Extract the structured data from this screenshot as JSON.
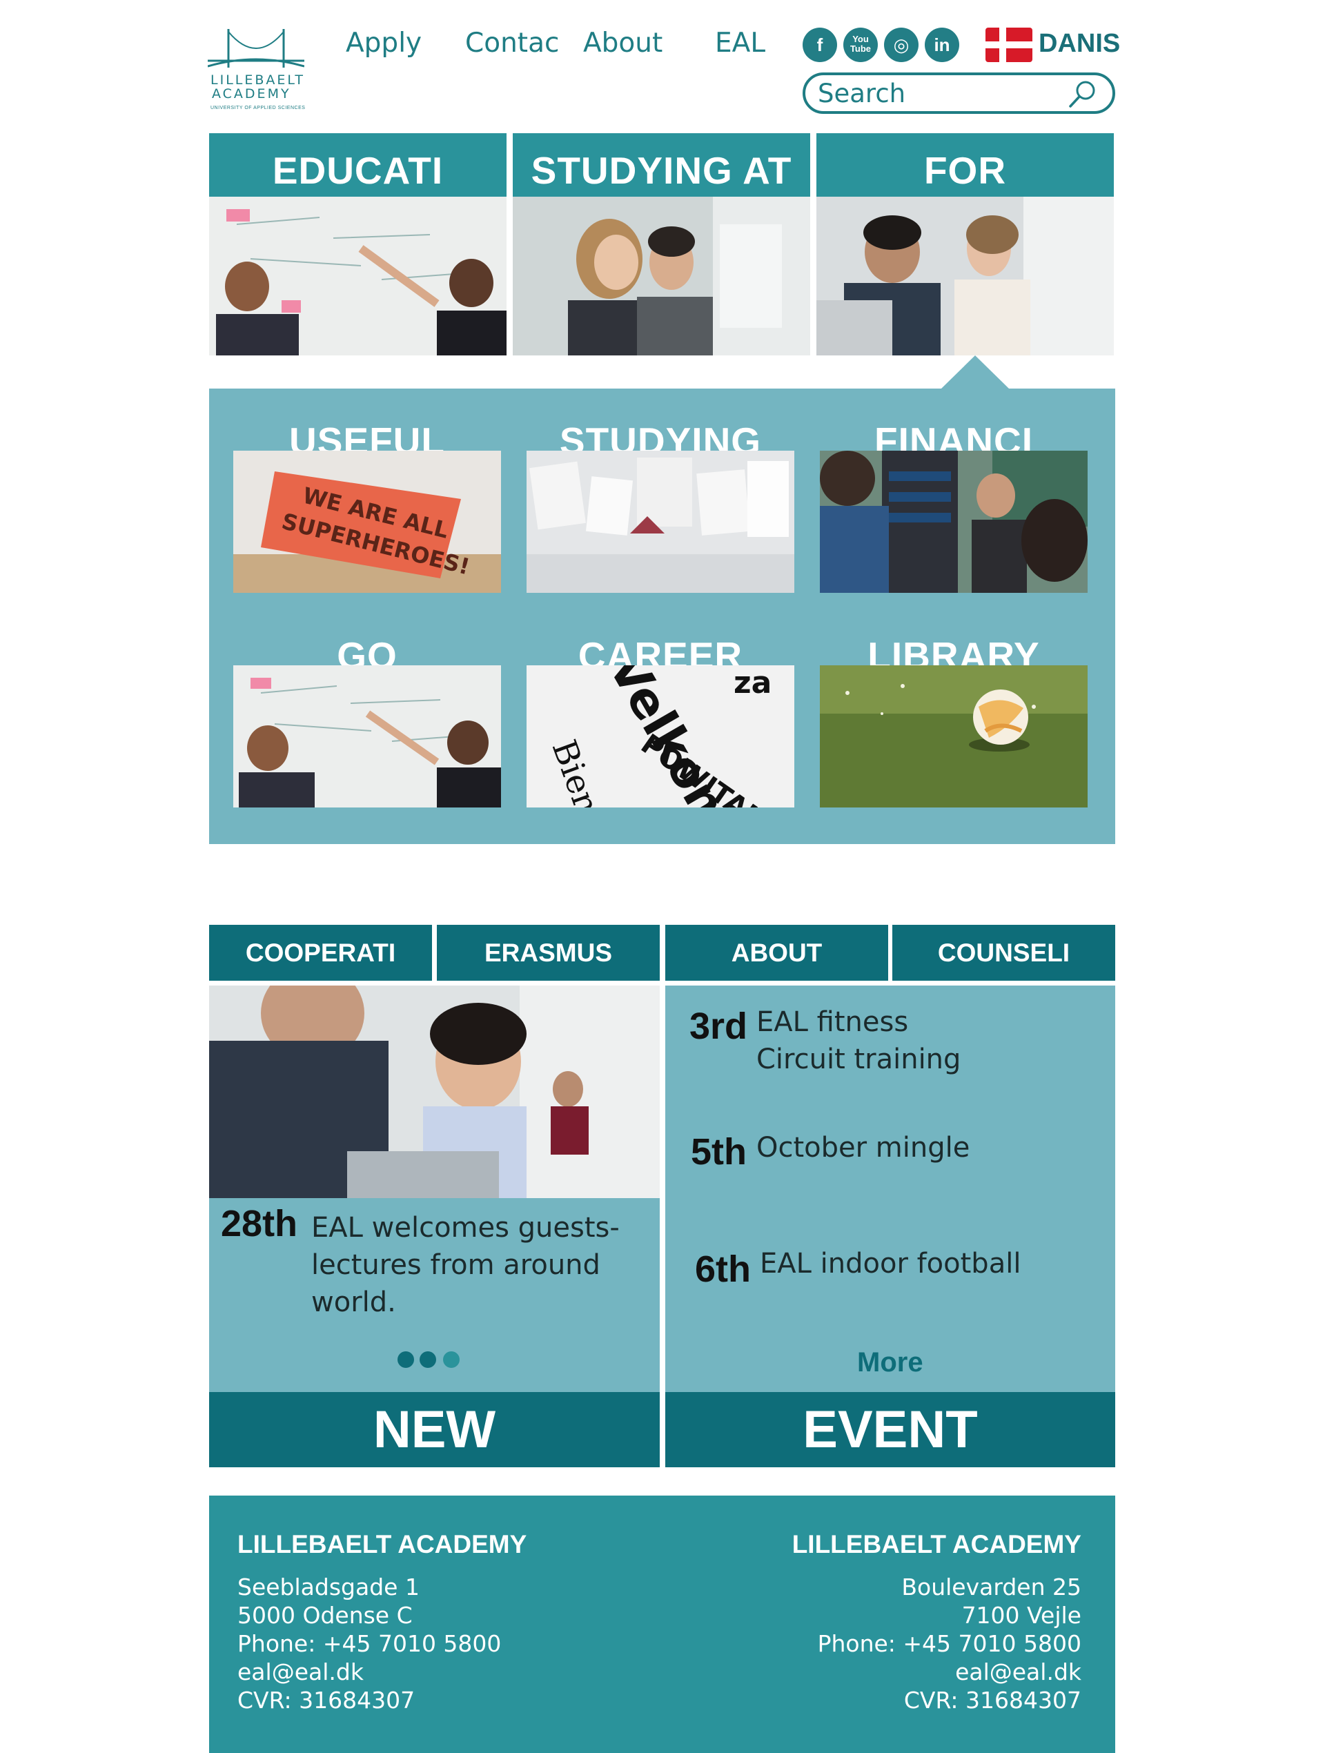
{
  "header": {
    "logo": {
      "line1": "LILLEBAELT",
      "line2": "ACADEMY",
      "tagline": "UNIVERSITY OF APPLIED SCIENCES"
    },
    "nav": [
      {
        "label": "Apply"
      },
      {
        "label": "Contac"
      },
      {
        "label": "About"
      },
      {
        "label": "EAL"
      }
    ],
    "social": [
      {
        "icon": "facebook-icon",
        "glyph": "f"
      },
      {
        "icon": "youtube-icon",
        "glyph": "You Tube"
      },
      {
        "icon": "instagram-icon",
        "glyph": "◎"
      },
      {
        "icon": "linkedin-icon",
        "glyph": "in"
      }
    ],
    "language": "DANIS",
    "search_placeholder": "Search"
  },
  "top_cards": [
    {
      "title": "EDUCATI"
    },
    {
      "title": "STUDYING AT"
    },
    {
      "title": "FOR"
    }
  ],
  "sub_cards": [
    {
      "title": "USEFUL"
    },
    {
      "title": "STUDYING"
    },
    {
      "title": "FINANCI"
    },
    {
      "title": "GO"
    },
    {
      "title": "CAREER"
    },
    {
      "title": "LIBRARY"
    }
  ],
  "tabs": [
    {
      "label": "COOPERATI"
    },
    {
      "label": "ERASMUS"
    },
    {
      "label": "ABOUT"
    },
    {
      "label": "COUNSELI"
    }
  ],
  "news": {
    "date": "28th",
    "text": "EAL welcomes guests-lectures from around world.",
    "band_label": "NEW"
  },
  "events": {
    "items": [
      {
        "date": "3rd",
        "line1": "EAL fitness",
        "line2": "Circuit training"
      },
      {
        "date": "5th",
        "line1": "October mingle"
      },
      {
        "date": "6th",
        "line1": "EAL indoor football"
      }
    ],
    "more_label": "More",
    "band_label": "EVENT"
  },
  "footer": {
    "left": {
      "title": "LILLEBAELT ACADEMY",
      "lines": [
        "Seebladsgade 1",
        "5000 Odense C",
        "Phone: +45 7010 5800",
        "eal@eal.dk",
        "CVR: 31684307"
      ]
    },
    "right": {
      "title": "LILLEBAELT ACADEMY",
      "lines": [
        "Boulevarden 25",
        "7100 Vejle",
        "Phone: +45 7010 5800",
        "eal@eal.dk",
        "CVR: 31684307"
      ]
    }
  },
  "colors": {
    "brand_teal": "#2a939b",
    "dark_teal": "#0e6d79",
    "light_teal": "#74b5c1",
    "text_teal": "#1f7d84",
    "flag_red": "#d71a28"
  }
}
